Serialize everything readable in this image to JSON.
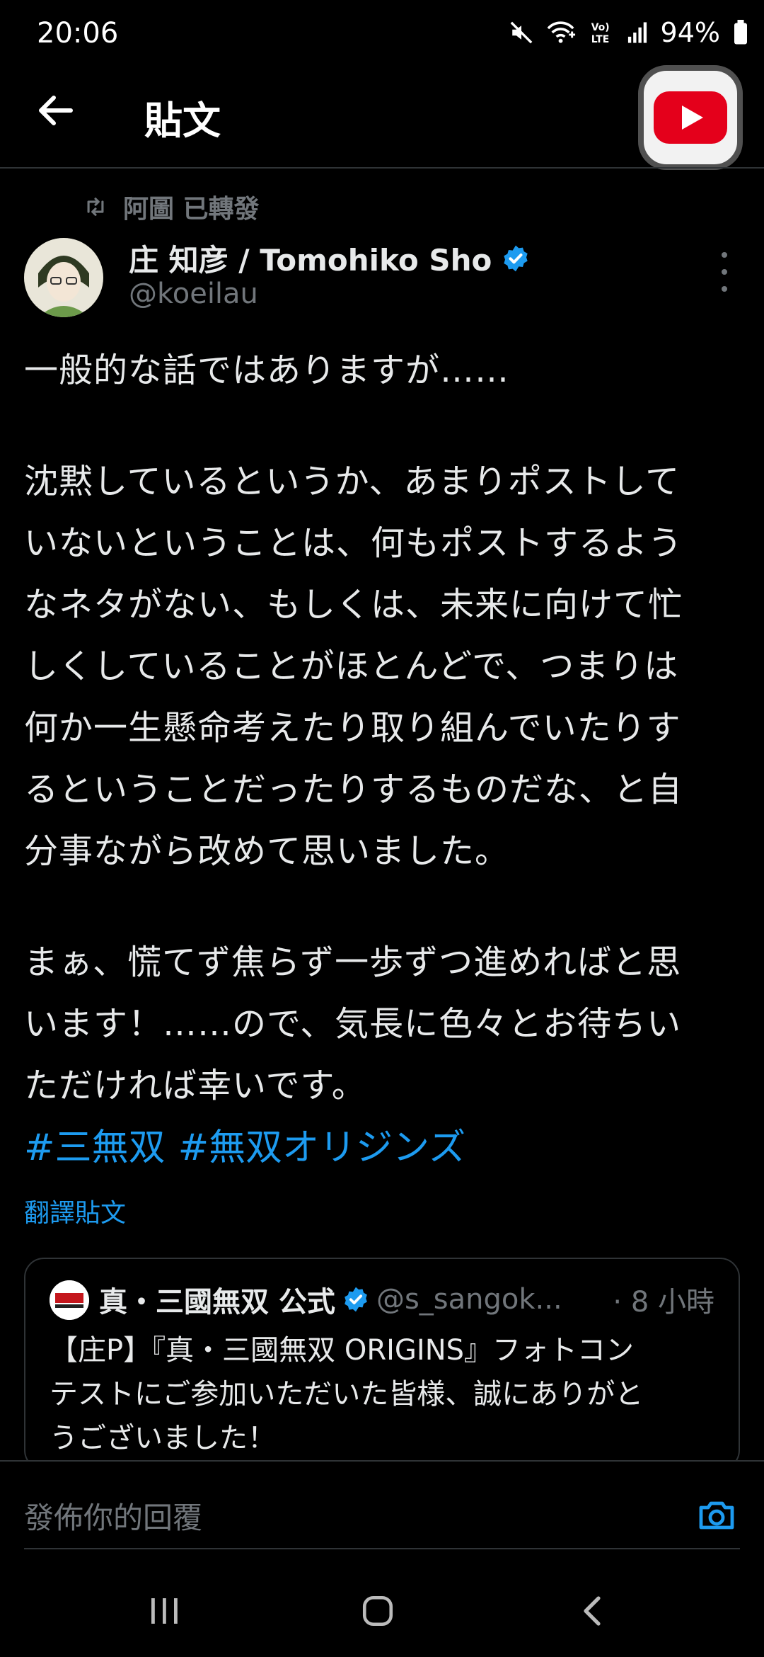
{
  "status_bar": {
    "time": "20:06",
    "battery": "94%",
    "icons": [
      "mute-icon",
      "wifi-calling-icon",
      "volte-icon",
      "signal-icon",
      "battery-icon"
    ]
  },
  "app_bar": {
    "title": "貼文",
    "back_icon": "back-arrow-icon",
    "overlay_icon": "youtube-icon"
  },
  "tweet": {
    "repost_label": "阿圖 已轉發",
    "author": {
      "name": "庄 知彦 / Tomohiko Sho",
      "handle": "@koeilau",
      "verified": true
    },
    "lines": [
      "一般的な話ではありますが……",
      "",
      "沈黙しているというか、あまりポストして",
      "いないということは、何もポストするよう",
      "なネタがない、もしくは、未来に向けて忙",
      "しくしていることがほとんどで、つまりは",
      "何か一生懸命考えたり取り組んでいたりす",
      "るということだったりするものだな、と自",
      "分事ながら改めて思いました。",
      "",
      "まぁ、慌てず焦らず一歩ずつ進めればと思",
      "います！……ので、気長に色々とお待ちい",
      "ただければ幸いです。"
    ],
    "hashtags": [
      "#三無双",
      "#無双オリジンズ"
    ],
    "translate_label": "翻譯貼文"
  },
  "quote": {
    "name": "真・三國無双 公式",
    "handle": "@s_sangok...",
    "time": "· 8 小時",
    "lines": [
      "【庄P】『真・三國無双 ORIGINS』フォトコン",
      "テストにご参加いただいた皆様、誠にありがと",
      "うございました！"
    ]
  },
  "reply": {
    "placeholder": "發佈你的回覆"
  },
  "colors": {
    "accent": "#1d9bf0",
    "muted": "#71767b",
    "background": "#000000",
    "youtube_red": "#e4001b"
  }
}
